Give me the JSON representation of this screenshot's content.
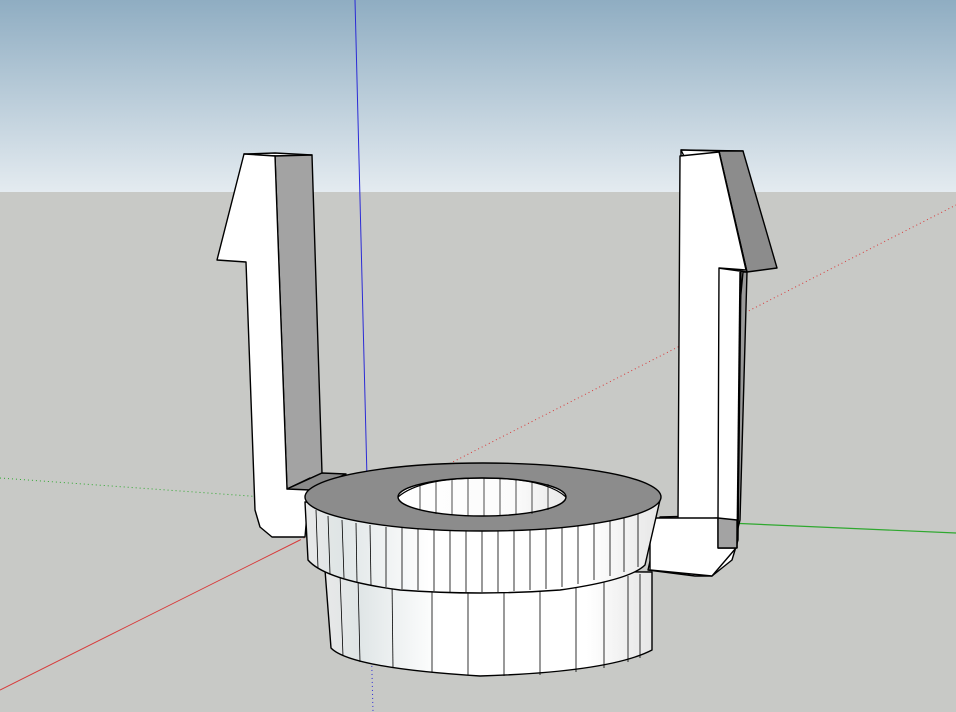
{
  "viewport": {
    "colors": {
      "sky_top": "#8fadc2",
      "sky_bottom": "#dfe7ed",
      "ground": "#c8c9c6",
      "face_light": "#ffffff",
      "face_shadow": "#a3a3a3",
      "face_dark": "#7d7d7d",
      "ring_top": "#8c8c8c",
      "edge": "#000000",
      "axis_red": "#d83a3a",
      "axis_green": "#2fa82f",
      "axis_blue": "#2b2bd6"
    },
    "axes": [
      "red-axis",
      "green-axis",
      "blue-axis"
    ],
    "model": "clip-with-ring-bushing"
  }
}
